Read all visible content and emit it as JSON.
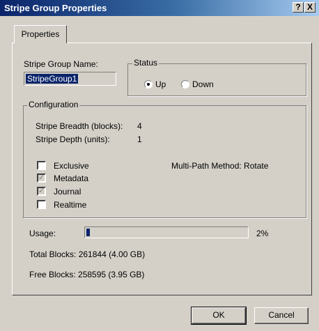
{
  "window": {
    "title": "Stripe Group Properties",
    "help_button": "?",
    "close_button": "X"
  },
  "tabs": [
    {
      "label": "Properties",
      "selected": true
    }
  ],
  "stripe_group_name": {
    "label": "Stripe Group Name:",
    "value": "StripeGroup1"
  },
  "status": {
    "legend": "Status",
    "options": [
      {
        "label": "Up",
        "selected": true
      },
      {
        "label": "Down",
        "selected": false
      }
    ]
  },
  "configuration": {
    "legend": "Configuration",
    "stripe_breadth_label": "Stripe Breadth (blocks):",
    "stripe_breadth_value": "4",
    "stripe_depth_label": "Stripe Depth (units):",
    "stripe_depth_value": "1",
    "checkboxes": [
      {
        "label": "Exclusive",
        "checked": false
      },
      {
        "label": "Metadata",
        "checked": true
      },
      {
        "label": "Journal",
        "checked": true
      },
      {
        "label": "Realtime",
        "checked": false
      }
    ],
    "multipath": "Multi-Path Method: Rotate"
  },
  "usage": {
    "label": "Usage:",
    "percent_text": "2%",
    "fraction": 0.02
  },
  "total_blocks": "Total Blocks:  261844 (4.00 GB)",
  "free_blocks": "Free Blocks:  258595 (3.95 GB)",
  "buttons": {
    "ok": "OK",
    "cancel": "Cancel"
  },
  "colors": {
    "title_start": "#0a246a",
    "title_end": "#a6caf0",
    "face": "#d4d0c8",
    "selection": "#0a246a"
  }
}
